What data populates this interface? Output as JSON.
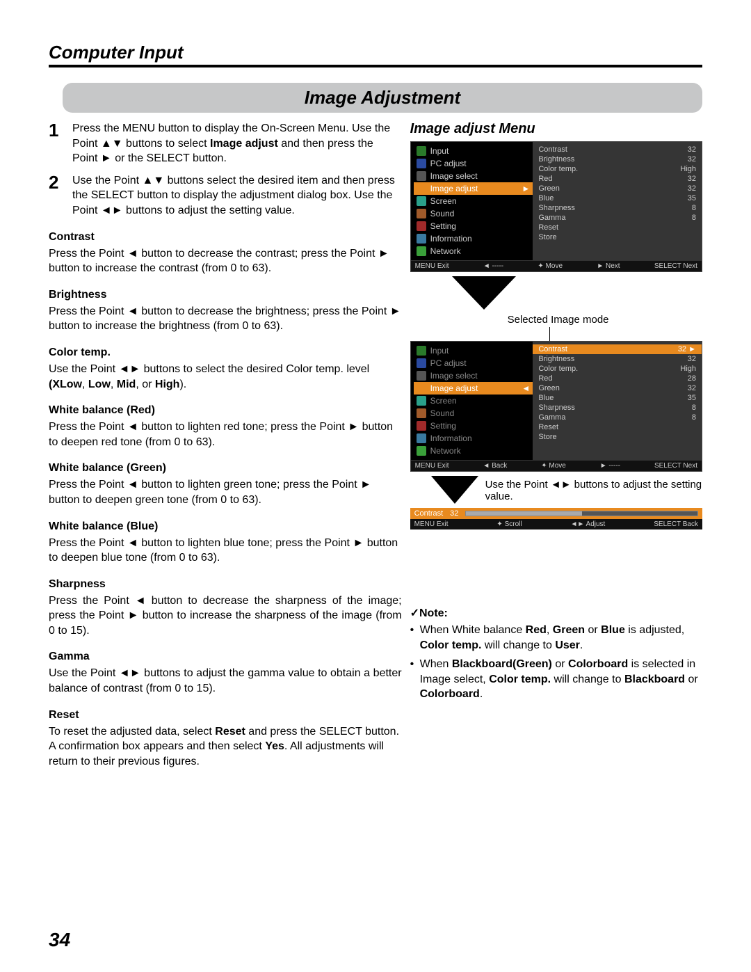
{
  "header": {
    "title": "Computer Input"
  },
  "section": {
    "title": "Image Adjustment"
  },
  "steps": [
    {
      "num": "1",
      "parts": [
        "Press the MENU button to display the On-Screen Menu. Use the Point ▲▼ buttons to select ",
        "Image adjust",
        " and then press the Point ► or the SELECT button."
      ]
    },
    {
      "num": "2",
      "parts": [
        "Use the Point ▲▼ buttons select the desired item and then press the SELECT button to display the adjustment dialog box. Use the Point ◄► buttons to adjust the setting value."
      ]
    }
  ],
  "items": [
    {
      "title": "Contrast",
      "body": "Press the Point ◄ button to decrease the contrast; press the Point ► button to increase the contrast (from 0 to 63)."
    },
    {
      "title": "Brightness",
      "body": "Press the Point ◄ button to decrease the brightness; press the Point ► button to increase the brightness (from 0 to 63)."
    },
    {
      "title": "Color temp.",
      "body_parts": [
        "Use the Point ◄► buttons to select the desired Color temp. level ",
        "(XLow",
        ", ",
        "Low",
        ", ",
        "Mid",
        ", or ",
        "High",
        ")."
      ]
    },
    {
      "title": "White balance (Red)",
      "body": "Press the Point ◄ button to lighten red tone; press the Point ► button to deepen red tone (from 0 to 63)."
    },
    {
      "title": "White balance (Green)",
      "body": "Press the Point ◄ button to lighten green tone; press the Point ► button to deepen green tone (from 0 to 63)."
    },
    {
      "title": "White balance (Blue)",
      "body": "Press the Point ◄ button to lighten blue tone; press the Point ► button to deepen blue tone (from 0 to 63)."
    },
    {
      "title": "Sharpness",
      "body": "Press the Point ◄ button to decrease the sharpness of the image; press the Point ► button to increase the sharpness of the image (from 0 to 15).",
      "justify": true
    },
    {
      "title": "Gamma",
      "body": "Use the Point ◄► buttons to adjust the gamma value to obtain a better balance of contrast (from 0 to 15).",
      "justify": true
    },
    {
      "title": "Reset",
      "body_parts": [
        "To reset the adjusted data, select ",
        "Reset",
        " and press the SELECT button. A confirmation box appears and then select ",
        "Yes",
        ". All adjustments will return to their previous figures."
      ]
    }
  ],
  "right": {
    "title": "Image adjust Menu",
    "selected_label": "Selected Image mode",
    "caption2": "Use the Point ◄► buttons to adjust the setting value.",
    "menu": [
      "Input",
      "PC adjust",
      "Image select",
      "Image adjust",
      "Screen",
      "Sound",
      "Setting",
      "Information",
      "Network"
    ],
    "values1": [
      {
        "k": "Contrast",
        "v": "32"
      },
      {
        "k": "Brightness",
        "v": "32"
      },
      {
        "k": "Color temp.",
        "v": "High"
      },
      {
        "k": "Red",
        "v": "32"
      },
      {
        "k": "Green",
        "v": "32"
      },
      {
        "k": "Blue",
        "v": "35"
      },
      {
        "k": "Sharpness",
        "v": "8"
      },
      {
        "k": "Gamma",
        "v": "8"
      },
      {
        "k": "Reset",
        "v": ""
      },
      {
        "k": "Store",
        "v": ""
      }
    ],
    "values2": [
      {
        "k": "Contrast",
        "v": "32",
        "hl": true
      },
      {
        "k": "Brightness",
        "v": "32"
      },
      {
        "k": "Color temp.",
        "v": "High"
      },
      {
        "k": "Red",
        "v": "28"
      },
      {
        "k": "Green",
        "v": "32"
      },
      {
        "k": "Blue",
        "v": "35"
      },
      {
        "k": "Sharpness",
        "v": "8"
      },
      {
        "k": "Gamma",
        "v": "8"
      },
      {
        "k": "Reset",
        "v": ""
      },
      {
        "k": "Store",
        "v": ""
      }
    ],
    "foot": {
      "exit": "MENU Exit",
      "back": "◄ -----",
      "back2": "◄ Back",
      "move": "✦ Move",
      "next": "► Next",
      "next2": "► -----",
      "select": "SELECT Next"
    },
    "adjust": {
      "label": "Contrast",
      "value": "32"
    },
    "adjust_foot": {
      "exit": "MENU Exit",
      "scroll": "✦ Scroll",
      "adjust": "◄► Adjust",
      "back": "SELECT Back"
    }
  },
  "note": {
    "title": "✓Note:",
    "items": [
      [
        "When White balance ",
        "Red",
        ", ",
        "Green",
        " or ",
        "Blue",
        " is adjusted, ",
        "Color temp.",
        " will change to ",
        "User",
        "."
      ],
      [
        "When ",
        "Blackboard(Green)",
        " or ",
        "Colorboard",
        " is selected in Image select, ",
        "Color temp.",
        " will change to ",
        "Blackboard",
        " or ",
        "Colorboard",
        "."
      ]
    ]
  },
  "page_number": "34"
}
